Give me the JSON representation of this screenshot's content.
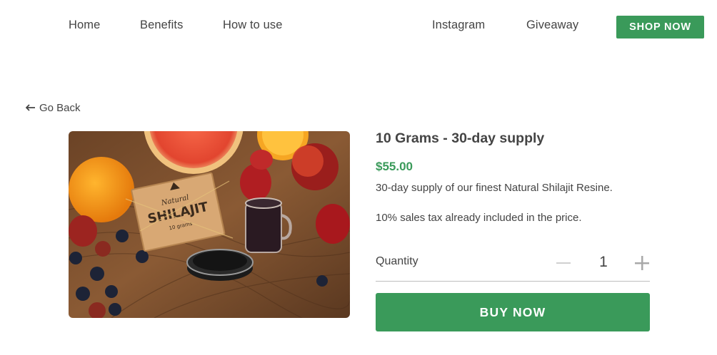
{
  "nav": {
    "home": "Home",
    "benefits": "Benefits",
    "how_to_use": "How to use",
    "instagram": "Instagram",
    "giveaway": "Giveaway",
    "shop_now": "SHOP NOW"
  },
  "back": {
    "label": "Go Back",
    "icon": "arrow-left-icon"
  },
  "product": {
    "title": "10 Grams - 30-day supply",
    "price": "$55.00",
    "description": "30-day supply of our finest Natural Shilajit Resine.",
    "tax_note": "10% sales tax already included in the price.",
    "image_brand": "SHILAJIT",
    "image_brand_script": "Natural",
    "image_weight": "10 grams"
  },
  "quantity": {
    "label": "Quantity",
    "value": "1"
  },
  "buy_label": "BUY NOW",
  "colors": {
    "brand_green": "#3a9a5a",
    "text": "#444444"
  }
}
